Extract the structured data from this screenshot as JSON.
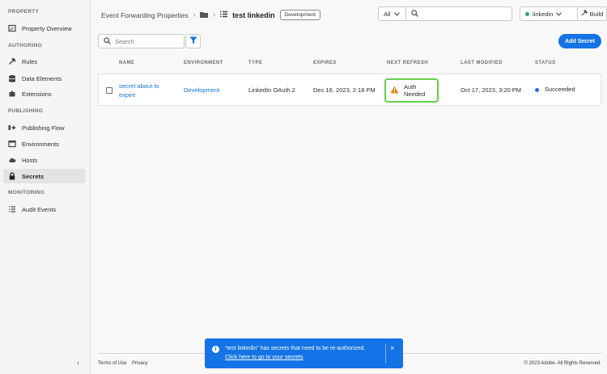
{
  "colors": {
    "accent": "#1473e6",
    "success": "#2d9d78",
    "warning": "#e68619",
    "highlight": "#63d04b"
  },
  "sidebar": {
    "sections": {
      "property": "PROPERTY",
      "authoring": "AUTHORING",
      "publishing": "PUBLISHING",
      "monitoring": "MONITORING"
    },
    "items": [
      {
        "label": "Property Overview",
        "icon": "overview-icon"
      },
      {
        "label": "Rules",
        "icon": "rules-icon"
      },
      {
        "label": "Data Elements",
        "icon": "database-icon"
      },
      {
        "label": "Extensions",
        "icon": "extensions-icon"
      },
      {
        "label": "Publishing Flow",
        "icon": "publishing-flow-icon"
      },
      {
        "label": "Environments",
        "icon": "environments-icon"
      },
      {
        "label": "Hosts",
        "icon": "cloud-icon"
      },
      {
        "label": "Secrets",
        "icon": "lock-icon",
        "active": true
      },
      {
        "label": "Audit Events",
        "icon": "list-icon"
      }
    ]
  },
  "header": {
    "breadcrumb_root": "Event Forwarding Properties",
    "property_name": "test linkedin",
    "environment_badge": "Development",
    "scope": "All",
    "library": "linkedin",
    "build_label": "Build"
  },
  "toolbar": {
    "search_placeholder": "Search",
    "add_label": "Add Secret"
  },
  "table": {
    "columns": [
      "NAME",
      "ENVIRONMENT",
      "TYPE",
      "EXPIRES",
      "NEXT REFRESH",
      "LAST MODIFIED",
      "STATUS"
    ],
    "rows": [
      {
        "name_line1": "secret about to",
        "name_line2": "expire",
        "environment": "Development",
        "type": "LinkedIn OAuth 2",
        "expires": "Dec 16, 2023, 2:18 PM",
        "next_refresh": "Auth Needed",
        "last_modified": "Oct 17, 2023, 3:20 PM",
        "status": "Succeeded"
      }
    ]
  },
  "footer": {
    "terms": "Terms of Use",
    "privacy": "Privacy",
    "copyright": "© 2023 Adobe. All Rights Reserved."
  },
  "toast": {
    "message": "“test linkedin” has secrets that need to be re-authorized.",
    "link": "Click here to go to your secrets"
  }
}
